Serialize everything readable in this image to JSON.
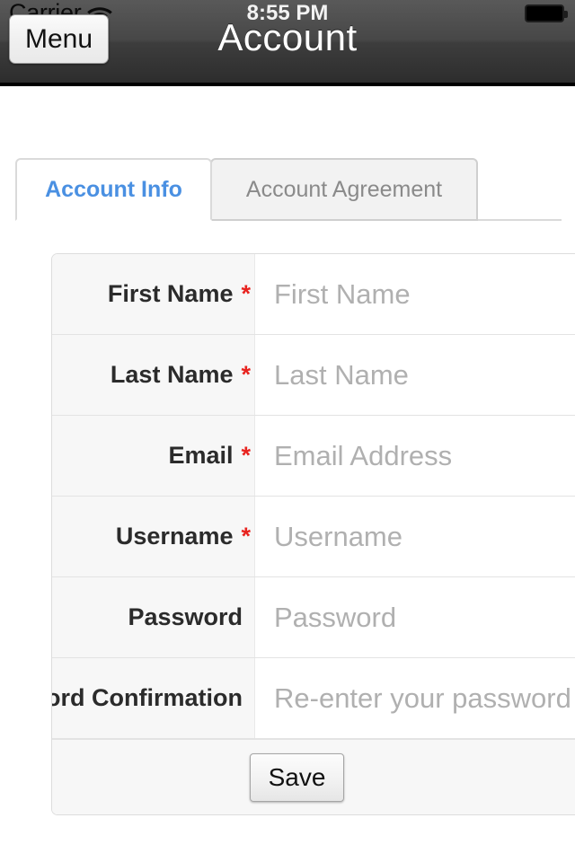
{
  "status_bar": {
    "carrier": "Carrier",
    "wifi_icon": "wifi-icon",
    "time": "8:55 PM",
    "battery_icon": "battery-full-icon"
  },
  "nav_bar": {
    "menu_label": "Menu",
    "title": "Account"
  },
  "tabs": [
    {
      "label": "Account Info",
      "active": true
    },
    {
      "label": "Account Agreement",
      "active": false
    }
  ],
  "form": {
    "rows": [
      {
        "label": "First Name",
        "required": true,
        "star": "*",
        "placeholder": "First Name",
        "value": ""
      },
      {
        "label": "Last Name",
        "required": true,
        "star": "*",
        "placeholder": "Last Name",
        "value": ""
      },
      {
        "label": "Email",
        "required": true,
        "star": "*",
        "placeholder": "Email Address",
        "value": ""
      },
      {
        "label": "Username",
        "required": true,
        "star": "*",
        "placeholder": "Username",
        "value": ""
      },
      {
        "label": "Password",
        "required": false,
        "star": "",
        "placeholder": "Password",
        "value": ""
      },
      {
        "label": "Password Confirmation",
        "required": false,
        "star": "",
        "placeholder": "Re-enter your password",
        "value": ""
      }
    ],
    "save_label": "Save"
  },
  "colors": {
    "tab_active_text": "#4a90e2",
    "tab_inactive_text": "#8a8a8a",
    "required_star": "#e8231f",
    "label_text": "#2b2b2b",
    "placeholder_text": "#b0b0b0",
    "nav_bar_bg": "#474747",
    "label_cell_bg": "#f7f7f7"
  }
}
